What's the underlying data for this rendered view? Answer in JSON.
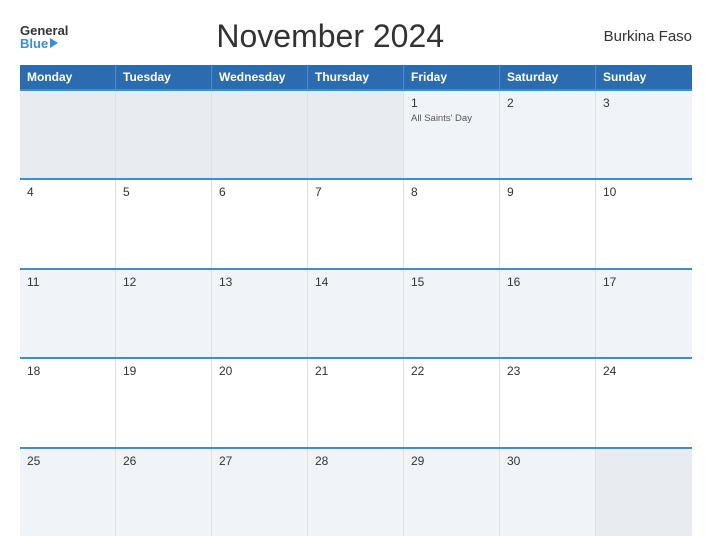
{
  "header": {
    "logo_general": "General",
    "logo_blue": "Blue",
    "title": "November 2024",
    "country": "Burkina Faso"
  },
  "weekdays": [
    "Monday",
    "Tuesday",
    "Wednesday",
    "Thursday",
    "Friday",
    "Saturday",
    "Sunday"
  ],
  "weeks": [
    [
      {
        "num": "",
        "holiday": "",
        "empty": true
      },
      {
        "num": "",
        "holiday": "",
        "empty": true
      },
      {
        "num": "",
        "holiday": "",
        "empty": true
      },
      {
        "num": "",
        "holiday": "",
        "empty": true
      },
      {
        "num": "1",
        "holiday": "All Saints' Day",
        "empty": false
      },
      {
        "num": "2",
        "holiday": "",
        "empty": false
      },
      {
        "num": "3",
        "holiday": "",
        "empty": false
      }
    ],
    [
      {
        "num": "4",
        "holiday": "",
        "empty": false
      },
      {
        "num": "5",
        "holiday": "",
        "empty": false
      },
      {
        "num": "6",
        "holiday": "",
        "empty": false
      },
      {
        "num": "7",
        "holiday": "",
        "empty": false
      },
      {
        "num": "8",
        "holiday": "",
        "empty": false
      },
      {
        "num": "9",
        "holiday": "",
        "empty": false
      },
      {
        "num": "10",
        "holiday": "",
        "empty": false
      }
    ],
    [
      {
        "num": "11",
        "holiday": "",
        "empty": false
      },
      {
        "num": "12",
        "holiday": "",
        "empty": false
      },
      {
        "num": "13",
        "holiday": "",
        "empty": false
      },
      {
        "num": "14",
        "holiday": "",
        "empty": false
      },
      {
        "num": "15",
        "holiday": "",
        "empty": false
      },
      {
        "num": "16",
        "holiday": "",
        "empty": false
      },
      {
        "num": "17",
        "holiday": "",
        "empty": false
      }
    ],
    [
      {
        "num": "18",
        "holiday": "",
        "empty": false
      },
      {
        "num": "19",
        "holiday": "",
        "empty": false
      },
      {
        "num": "20",
        "holiday": "",
        "empty": false
      },
      {
        "num": "21",
        "holiday": "",
        "empty": false
      },
      {
        "num": "22",
        "holiday": "",
        "empty": false
      },
      {
        "num": "23",
        "holiday": "",
        "empty": false
      },
      {
        "num": "24",
        "holiday": "",
        "empty": false
      }
    ],
    [
      {
        "num": "25",
        "holiday": "",
        "empty": false
      },
      {
        "num": "26",
        "holiday": "",
        "empty": false
      },
      {
        "num": "27",
        "holiday": "",
        "empty": false
      },
      {
        "num": "28",
        "holiday": "",
        "empty": false
      },
      {
        "num": "29",
        "holiday": "",
        "empty": false
      },
      {
        "num": "30",
        "holiday": "",
        "empty": false
      },
      {
        "num": "",
        "holiday": "",
        "empty": true
      }
    ]
  ]
}
